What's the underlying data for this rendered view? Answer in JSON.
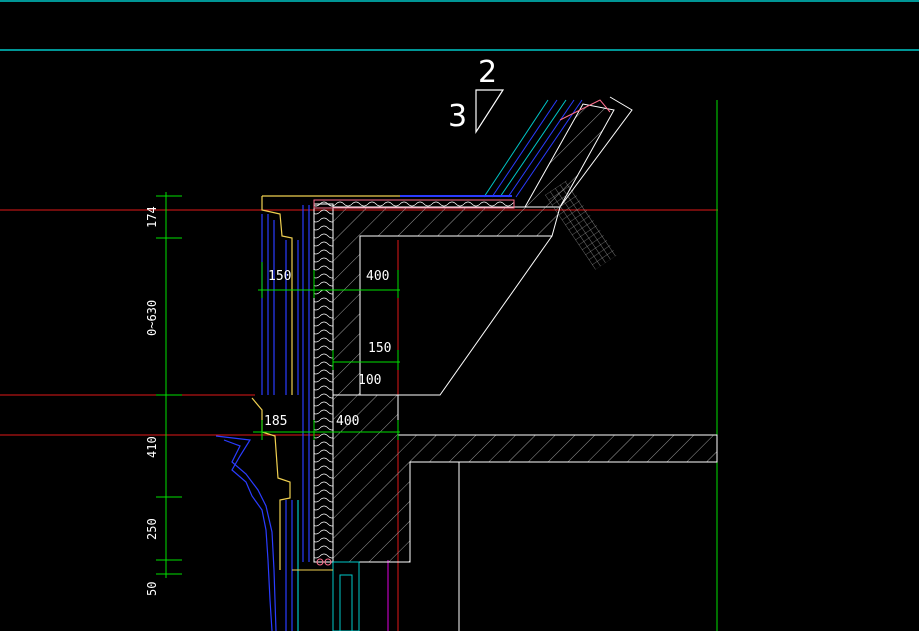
{
  "drawing": {
    "background": "#000000",
    "colors": {
      "cyan": "#00c8c8",
      "red": "#e01818",
      "green": "#00e000",
      "white": "#ffffff",
      "blue": "#2a3cff",
      "yellow": "#f0d050",
      "magenta": "#e000e0",
      "pink": "#ff6e8c",
      "gray": "#8c8c8c"
    },
    "slope": {
      "rise": "2",
      "run": "3"
    },
    "horizontal_dims": {
      "d150_top": "150",
      "d400_top": "400",
      "d150_mid": "150",
      "d100": "100",
      "d185": "185",
      "d400_bottom": "400"
    },
    "vertical_dims": {
      "v174": "174",
      "v0630": "0~630",
      "v410": "410",
      "v250": "250",
      "v50": "50"
    }
  }
}
